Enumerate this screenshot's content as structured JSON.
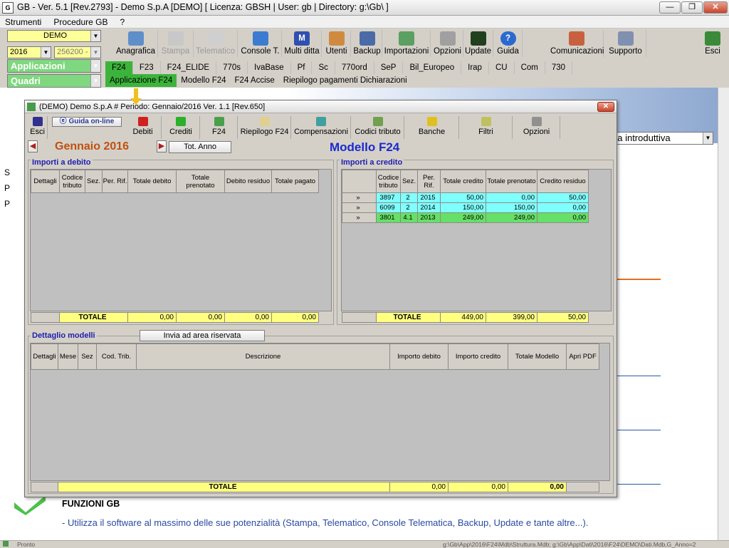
{
  "app": {
    "title": "GB - Ver. 5.1 [Rev.2793] -  Demo S.p.A [DEMO]     [ Licenza: GBSH | User: gb | Directory: g:\\Gb\\ ]"
  },
  "menu": [
    "Strumenti",
    "Procedure GB",
    "?"
  ],
  "selectors": {
    "company": "DEMO",
    "year": "2016",
    "code": "256200 -",
    "applicazioni": "Applicazioni",
    "quadri": "Quadri"
  },
  "toolbar": [
    {
      "label": "Anagrafica",
      "icon": "anagrafica-icon"
    },
    {
      "label": "Stampa",
      "icon": "printer-icon"
    },
    {
      "label": "Telematico",
      "icon": "telematico-icon"
    },
    {
      "label": "Console T.",
      "icon": "console-icon"
    },
    {
      "label": "Multi ditta",
      "icon": "multi-ditta-icon"
    },
    {
      "label": "Utenti",
      "icon": "users-icon"
    },
    {
      "label": "Backup",
      "icon": "backup-icon"
    },
    {
      "label": "Importazioni",
      "icon": "import-icon"
    },
    {
      "label": "Opzioni",
      "icon": "wrench-icon"
    },
    {
      "label": "Update",
      "icon": "update-icon"
    },
    {
      "label": "Guida",
      "icon": "help-icon"
    },
    {
      "label": "Comunicazioni",
      "icon": "comunicazioni-icon"
    },
    {
      "label": "Supporto",
      "icon": "supporto-icon"
    },
    {
      "label": "Esci",
      "icon": "exit-icon"
    }
  ],
  "tabs1": [
    "F24",
    "F23",
    "F24_ELIDE",
    "770s",
    "IvaBase",
    "Pf",
    "Sc",
    "770ord",
    "SeP",
    "Bil_Europeo",
    "Irap",
    "CU",
    "Com",
    "730"
  ],
  "tabs2": [
    "Applicazione F24",
    "Modello F24",
    "F24 Accise",
    "Riepilogo pagamenti Dichiarazioni"
  ],
  "bgpage": {
    "dropdown": "da introduttiva",
    "funzioni_title": "FUNZIONI GB",
    "funzioni_text": "- Utilizza il software al massimo delle sue potenzialità (Stampa, Telematico, Console Telematica, Backup, Update e tante altre...).",
    "left_letters": [
      "S",
      "P",
      "P"
    ]
  },
  "window": {
    "title": "(DEMO) Demo S.p.A  # Periodo: Gennaio/2016 Ver. 1.1 [Rev.650]",
    "guida": "Guida on-line",
    "toolbar": [
      "Esci",
      "Debiti",
      "Crediti",
      "F24",
      "Riepilogo F24",
      "Compensazioni",
      "Codici tributo",
      "Banche",
      "Filtri",
      "Opzioni"
    ],
    "period": "Gennaio 2016",
    "tot_anno": "Tot. Anno",
    "heading": "Modello F24",
    "debito": {
      "title": "Importi a debito",
      "headers": [
        "Dettagli",
        "Codice tributo",
        "Sez.",
        "Per. Rif.",
        "Totale debito",
        "Totale prenotato",
        "Debito residuo",
        "Totale pagato"
      ],
      "total_label": "TOTALE",
      "totals": [
        "0,00",
        "0,00",
        "0,00",
        "0,00"
      ]
    },
    "credito": {
      "title": "Importi a credito",
      "headers": [
        "Codice tributo",
        "Sez.",
        "Per. Rif.",
        "Totale credito",
        "Totale prenotato",
        "Credito residuo"
      ],
      "rows": [
        {
          "expand": "»",
          "codice": "3897",
          "sez": "2",
          "per": "2015",
          "credito": "50,00",
          "prenotato": "0,00",
          "residuo": "50,00",
          "color": "#80ffff"
        },
        {
          "expand": "»",
          "codice": "6099",
          "sez": "2",
          "per": "2014",
          "credito": "150,00",
          "prenotato": "150,00",
          "residuo": "0,00",
          "color": "#80ffff"
        },
        {
          "expand": "»",
          "codice": "3801",
          "sez": "4.1",
          "per": "2013",
          "credito": "249,00",
          "prenotato": "249,00",
          "residuo": "0,00",
          "color": "#66e066"
        }
      ],
      "total_label": "TOTALE",
      "totals": [
        "449,00",
        "399,00",
        "50,00"
      ]
    },
    "dettaglio": {
      "title": "Dettaglio modelli",
      "invia": "Invia ad area riservata",
      "headers": [
        "Dettagli",
        "Mese",
        "Sez",
        "Cod. Trib.",
        "Descrizione",
        "Importo debito",
        "Importo credito",
        "Totale Modello",
        "Apri PDF"
      ],
      "total_label": "TOTALE",
      "totals": [
        "0,00",
        "0,00",
        "0,00"
      ]
    }
  },
  "status": {
    "left": "Pronto",
    "right": "g:\\Gb\\App\\2016\\F24\\Mdb\\Struttura.Mdb; g:\\Gb\\App\\Dati\\2016\\F24\\DEMO\\Dati.Mdb,G_Anno=2"
  }
}
